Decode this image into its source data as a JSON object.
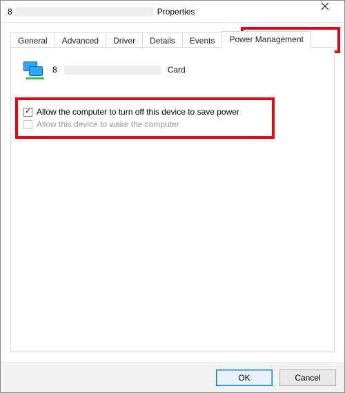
{
  "window": {
    "title_prefix": "8",
    "title_suffix": "Properties"
  },
  "tabs": {
    "items": [
      {
        "label": "General"
      },
      {
        "label": "Advanced"
      },
      {
        "label": "Driver"
      },
      {
        "label": "Details"
      },
      {
        "label": "Events"
      },
      {
        "label": "Power Management"
      }
    ],
    "active": 5
  },
  "device": {
    "name_prefix": "8",
    "name_suffix": "Card"
  },
  "options": {
    "allow_turn_off": {
      "label": "Allow the computer to turn off this device to save power",
      "checked": true,
      "enabled": true
    },
    "allow_wake": {
      "label": "Allow this device to wake the computer",
      "checked": false,
      "enabled": false
    }
  },
  "buttons": {
    "ok": "OK",
    "cancel": "Cancel"
  }
}
